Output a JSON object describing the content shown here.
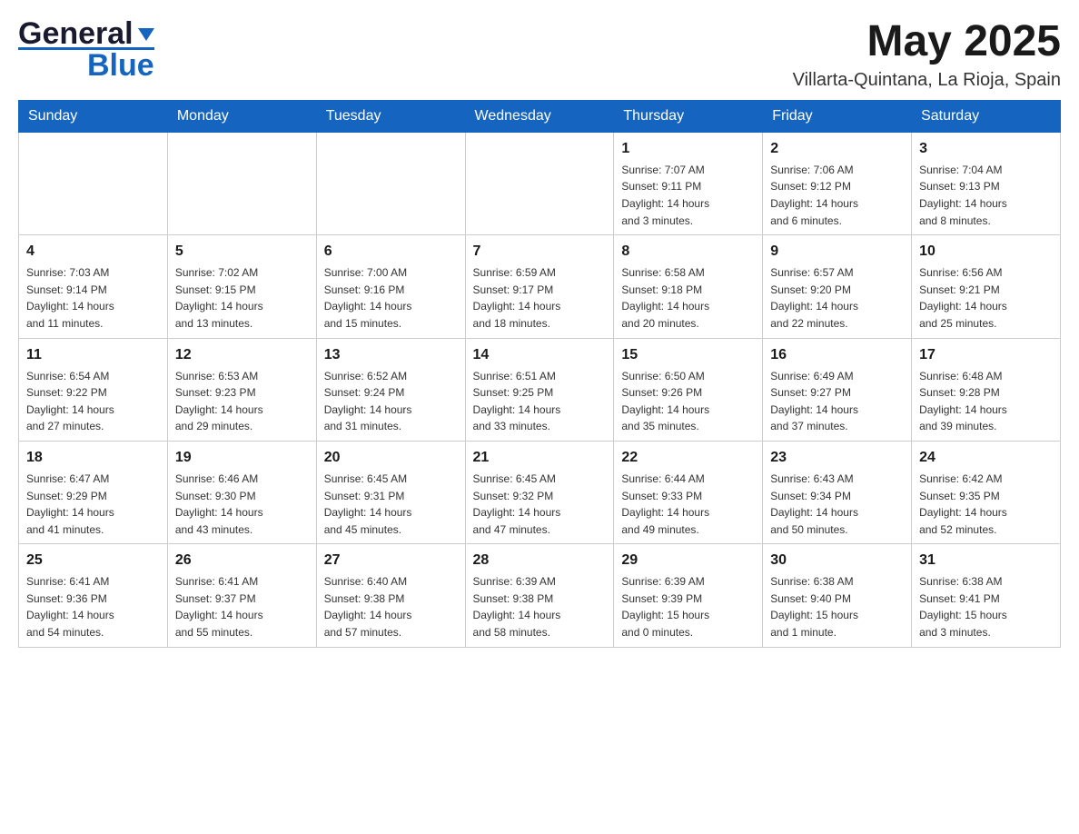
{
  "header": {
    "logo": {
      "line1": "General",
      "line2": "Blue",
      "triangle": "▶"
    },
    "month_title": "May 2025",
    "location": "Villarta-Quintana, La Rioja, Spain"
  },
  "weekdays": [
    "Sunday",
    "Monday",
    "Tuesday",
    "Wednesday",
    "Thursday",
    "Friday",
    "Saturday"
  ],
  "weeks": [
    [
      {
        "day": "",
        "info": ""
      },
      {
        "day": "",
        "info": ""
      },
      {
        "day": "",
        "info": ""
      },
      {
        "day": "",
        "info": ""
      },
      {
        "day": "1",
        "info": "Sunrise: 7:07 AM\nSunset: 9:11 PM\nDaylight: 14 hours\nand 3 minutes."
      },
      {
        "day": "2",
        "info": "Sunrise: 7:06 AM\nSunset: 9:12 PM\nDaylight: 14 hours\nand 6 minutes."
      },
      {
        "day": "3",
        "info": "Sunrise: 7:04 AM\nSunset: 9:13 PM\nDaylight: 14 hours\nand 8 minutes."
      }
    ],
    [
      {
        "day": "4",
        "info": "Sunrise: 7:03 AM\nSunset: 9:14 PM\nDaylight: 14 hours\nand 11 minutes."
      },
      {
        "day": "5",
        "info": "Sunrise: 7:02 AM\nSunset: 9:15 PM\nDaylight: 14 hours\nand 13 minutes."
      },
      {
        "day": "6",
        "info": "Sunrise: 7:00 AM\nSunset: 9:16 PM\nDaylight: 14 hours\nand 15 minutes."
      },
      {
        "day": "7",
        "info": "Sunrise: 6:59 AM\nSunset: 9:17 PM\nDaylight: 14 hours\nand 18 minutes."
      },
      {
        "day": "8",
        "info": "Sunrise: 6:58 AM\nSunset: 9:18 PM\nDaylight: 14 hours\nand 20 minutes."
      },
      {
        "day": "9",
        "info": "Sunrise: 6:57 AM\nSunset: 9:20 PM\nDaylight: 14 hours\nand 22 minutes."
      },
      {
        "day": "10",
        "info": "Sunrise: 6:56 AM\nSunset: 9:21 PM\nDaylight: 14 hours\nand 25 minutes."
      }
    ],
    [
      {
        "day": "11",
        "info": "Sunrise: 6:54 AM\nSunset: 9:22 PM\nDaylight: 14 hours\nand 27 minutes."
      },
      {
        "day": "12",
        "info": "Sunrise: 6:53 AM\nSunset: 9:23 PM\nDaylight: 14 hours\nand 29 minutes."
      },
      {
        "day": "13",
        "info": "Sunrise: 6:52 AM\nSunset: 9:24 PM\nDaylight: 14 hours\nand 31 minutes."
      },
      {
        "day": "14",
        "info": "Sunrise: 6:51 AM\nSunset: 9:25 PM\nDaylight: 14 hours\nand 33 minutes."
      },
      {
        "day": "15",
        "info": "Sunrise: 6:50 AM\nSunset: 9:26 PM\nDaylight: 14 hours\nand 35 minutes."
      },
      {
        "day": "16",
        "info": "Sunrise: 6:49 AM\nSunset: 9:27 PM\nDaylight: 14 hours\nand 37 minutes."
      },
      {
        "day": "17",
        "info": "Sunrise: 6:48 AM\nSunset: 9:28 PM\nDaylight: 14 hours\nand 39 minutes."
      }
    ],
    [
      {
        "day": "18",
        "info": "Sunrise: 6:47 AM\nSunset: 9:29 PM\nDaylight: 14 hours\nand 41 minutes."
      },
      {
        "day": "19",
        "info": "Sunrise: 6:46 AM\nSunset: 9:30 PM\nDaylight: 14 hours\nand 43 minutes."
      },
      {
        "day": "20",
        "info": "Sunrise: 6:45 AM\nSunset: 9:31 PM\nDaylight: 14 hours\nand 45 minutes."
      },
      {
        "day": "21",
        "info": "Sunrise: 6:45 AM\nSunset: 9:32 PM\nDaylight: 14 hours\nand 47 minutes."
      },
      {
        "day": "22",
        "info": "Sunrise: 6:44 AM\nSunset: 9:33 PM\nDaylight: 14 hours\nand 49 minutes."
      },
      {
        "day": "23",
        "info": "Sunrise: 6:43 AM\nSunset: 9:34 PM\nDaylight: 14 hours\nand 50 minutes."
      },
      {
        "day": "24",
        "info": "Sunrise: 6:42 AM\nSunset: 9:35 PM\nDaylight: 14 hours\nand 52 minutes."
      }
    ],
    [
      {
        "day": "25",
        "info": "Sunrise: 6:41 AM\nSunset: 9:36 PM\nDaylight: 14 hours\nand 54 minutes."
      },
      {
        "day": "26",
        "info": "Sunrise: 6:41 AM\nSunset: 9:37 PM\nDaylight: 14 hours\nand 55 minutes."
      },
      {
        "day": "27",
        "info": "Sunrise: 6:40 AM\nSunset: 9:38 PM\nDaylight: 14 hours\nand 57 minutes."
      },
      {
        "day": "28",
        "info": "Sunrise: 6:39 AM\nSunset: 9:38 PM\nDaylight: 14 hours\nand 58 minutes."
      },
      {
        "day": "29",
        "info": "Sunrise: 6:39 AM\nSunset: 9:39 PM\nDaylight: 15 hours\nand 0 minutes."
      },
      {
        "day": "30",
        "info": "Sunrise: 6:38 AM\nSunset: 9:40 PM\nDaylight: 15 hours\nand 1 minute."
      },
      {
        "day": "31",
        "info": "Sunrise: 6:38 AM\nSunset: 9:41 PM\nDaylight: 15 hours\nand 3 minutes."
      }
    ]
  ]
}
